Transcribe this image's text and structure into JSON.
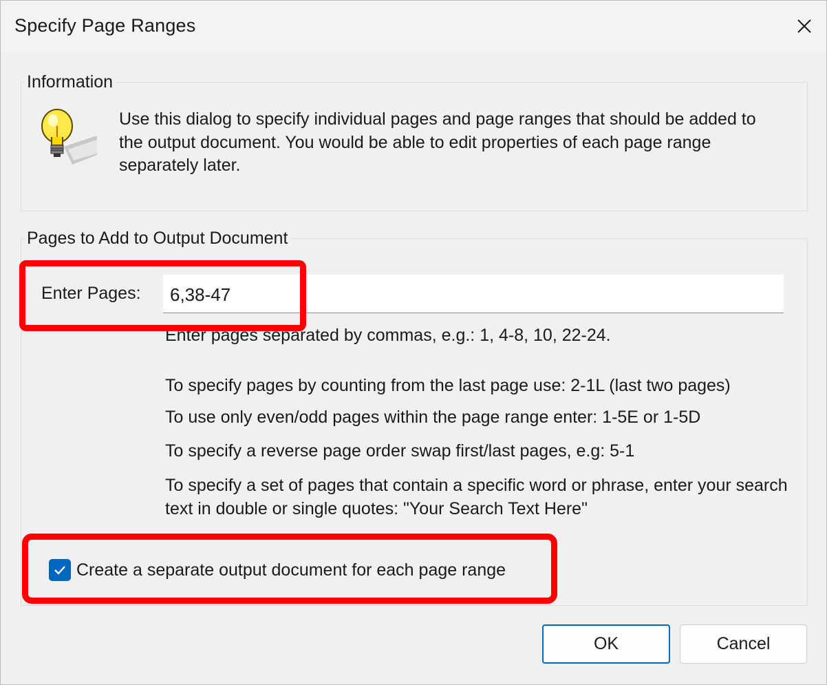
{
  "dialog": {
    "title": "Specify Page Ranges",
    "close_icon": "close-icon"
  },
  "information": {
    "group_title": "Information",
    "icon": "lightbulb-icon",
    "text": "Use this dialog to specify individual pages and page ranges that should be added to the output document. You would be able to edit properties of each page range separately later."
  },
  "pages": {
    "group_title": "Pages to Add to Output Document",
    "enter_label": "Enter Pages:",
    "enter_value": "6,38-47",
    "hints": [
      "Enter pages separated by commas, e.g.: 1, 4-8, 10, 22-24.",
      "To specify pages by counting from the last page use: 2-1L (last two pages)",
      "To use only even/odd pages within the page range enter: 1-5E or 1-5D",
      "To specify a reverse page order swap first/last pages, e.g: 5-1",
      "To specify a set of pages that contain a specific word or phrase, enter your search text in double or single quotes: \"Your Search Text Here\""
    ],
    "separate_checkbox": {
      "label": "Create a separate output document for each page range",
      "checked": true
    }
  },
  "buttons": {
    "ok": "OK",
    "cancel": "Cancel"
  },
  "colors": {
    "accent": "#0067c0",
    "highlight": "#ff0000"
  }
}
